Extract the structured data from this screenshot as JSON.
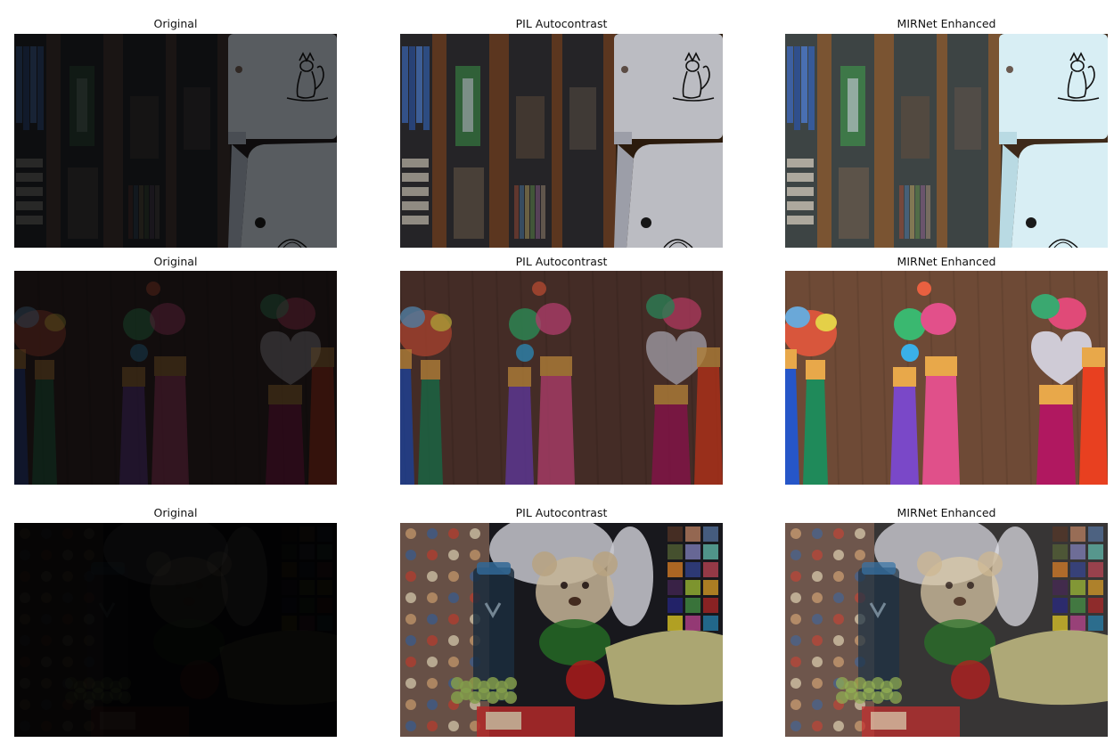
{
  "figure": {
    "rows": [
      {
        "scene": "bookcase-cat",
        "panels": [
          {
            "title": "Original",
            "brightness": 0.45
          },
          {
            "title": "PIL Autocontrast",
            "brightness": 0.85
          },
          {
            "title": "MIRNet Enhanced",
            "brightness": 1.0
          }
        ]
      },
      {
        "scene": "tassels",
        "panels": [
          {
            "title": "Original",
            "brightness": 0.4
          },
          {
            "title": "PIL Autocontrast",
            "brightness": 0.75
          },
          {
            "title": "MIRNet Enhanced",
            "brightness": 1.0
          }
        ]
      },
      {
        "scene": "teddy-bear",
        "panels": [
          {
            "title": "Original",
            "brightness": 0.18
          },
          {
            "title": "PIL Autocontrast",
            "brightness": 0.85
          },
          {
            "title": "MIRNet Enhanced",
            "brightness": 0.95
          }
        ]
      }
    ]
  }
}
